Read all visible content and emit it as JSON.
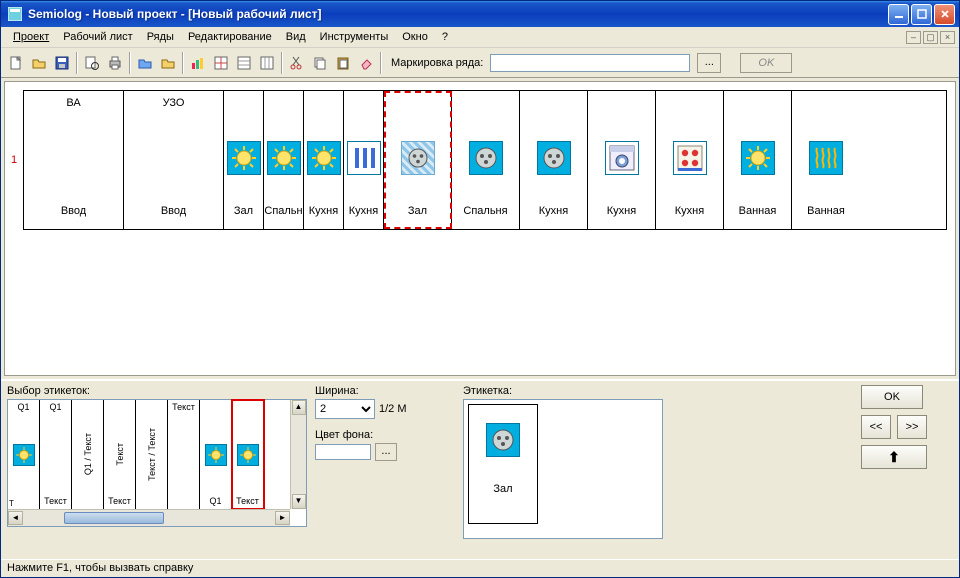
{
  "titlebar": {
    "text": "Semiolog - Новый проект - [Новый рабочий лист]"
  },
  "menu": {
    "items": [
      "Проект",
      "Рабочий лист",
      "Ряды",
      "Редактирование",
      "Вид",
      "Инструменты",
      "Окно",
      "?"
    ]
  },
  "toolbar": {
    "row_marking_label": "Маркировка ряда:",
    "row_marking_value": "",
    "ok_label": "OK",
    "ellipsis": "..."
  },
  "row": {
    "number": "1",
    "cells": [
      {
        "top": "ВА",
        "bottom": "Ввод",
        "width": 100,
        "icon": "",
        "selected": false
      },
      {
        "top": "УЗО",
        "bottom": "Ввод",
        "width": 100,
        "icon": "",
        "selected": false
      },
      {
        "top": "",
        "bottom": "Зал",
        "width": 40,
        "icon": "lamp",
        "selected": false
      },
      {
        "top": "",
        "bottom": "Спальн",
        "width": 40,
        "icon": "lamp",
        "selected": false
      },
      {
        "top": "",
        "bottom": "Кухня",
        "width": 40,
        "icon": "lamp",
        "selected": false
      },
      {
        "top": "",
        "bottom": "Кухня",
        "width": 40,
        "icon": "bars",
        "selected": false
      },
      {
        "top": "",
        "bottom": "Зал",
        "width": 68,
        "icon": "socket-pattern",
        "selected": true
      },
      {
        "top": "",
        "bottom": "Спальня",
        "width": 68,
        "icon": "socket",
        "selected": false
      },
      {
        "top": "",
        "bottom": "Кухня",
        "width": 68,
        "icon": "socket",
        "selected": false
      },
      {
        "top": "",
        "bottom": "Кухня",
        "width": 68,
        "icon": "washer",
        "selected": false
      },
      {
        "top": "",
        "bottom": "Кухня",
        "width": 68,
        "icon": "stove",
        "selected": false
      },
      {
        "top": "",
        "bottom": "Ванная",
        "width": 68,
        "icon": "lamp-big",
        "selected": false
      },
      {
        "top": "",
        "bottom": "Ванная",
        "width": 68,
        "icon": "heater",
        "selected": false
      }
    ]
  },
  "bottom": {
    "picker_label": "Выбор этикеток:",
    "width_label": "Ширина:",
    "width_value": "2",
    "width_unit": "1/2 M",
    "color_label": "Цвет фона:",
    "preview_label": "Этикетка:",
    "ok": "OK",
    "prev": "<<",
    "next": ">>",
    "up_arrow": "↑",
    "picker_cells": [
      {
        "small": "T",
        "top": "Q1",
        "mid": "",
        "bot": "",
        "icon": "lamp",
        "sel": false
      },
      {
        "small": "",
        "top": "Q1",
        "mid": "",
        "bot": "Текст",
        "icon": "",
        "sel": false
      },
      {
        "small": "",
        "top": "",
        "mid": "Q1 / Текст",
        "bot": "",
        "icon": "",
        "sel": false,
        "vertical": true
      },
      {
        "small": "",
        "top": "",
        "mid": "Текст",
        "bot": "Текст",
        "icon": "",
        "sel": false,
        "vertical": true
      },
      {
        "small": "",
        "top": "",
        "mid": "Текст / Текст",
        "bot": "",
        "icon": "",
        "sel": false,
        "vertical": true
      },
      {
        "small": "",
        "top": "Текст",
        "mid": "",
        "bot": "",
        "icon": "",
        "sel": false
      },
      {
        "small": "",
        "top": "",
        "mid": "",
        "bot": "Q1",
        "icon": "lamp",
        "sel": false
      },
      {
        "small": "",
        "top": "",
        "mid": "",
        "bot": "Текст",
        "icon": "lamp",
        "sel": true
      }
    ],
    "preview": {
      "icon": "socket",
      "label": "Зал"
    }
  },
  "status": {
    "text": "Нажмите F1, чтобы вызвать справку"
  }
}
